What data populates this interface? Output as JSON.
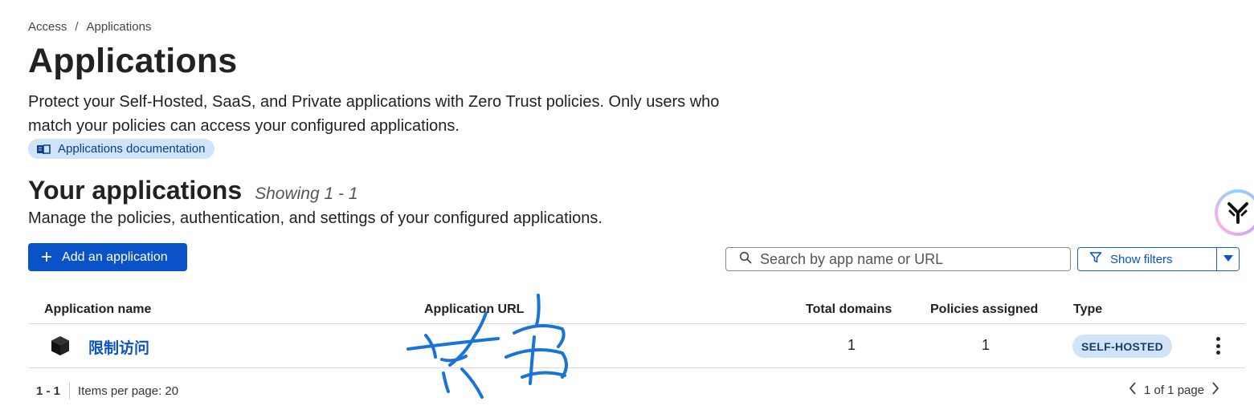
{
  "breadcrumb": {
    "items": [
      "Access",
      "Applications"
    ],
    "separator": "/"
  },
  "page": {
    "title": "Applications",
    "description": "Protect your Self-Hosted, SaaS, and Private applications with Zero Trust policies. Only users who match your policies can access your configured applications.",
    "doc_link_label": "Applications documentation",
    "doc_icon": "book-icon"
  },
  "section": {
    "title": "Your applications",
    "showing": "Showing 1 - 1",
    "description": "Manage the policies, authentication, and settings of your configured applications."
  },
  "toolbar": {
    "add_label": "Add an application",
    "search_placeholder": "Search by app name or URL",
    "search_value": "",
    "filters_label": "Show filters"
  },
  "table": {
    "columns": [
      "Application name",
      "Application URL",
      "Total domains",
      "Policies assigned",
      "Type"
    ],
    "rows": [
      {
        "icon": "cube-icon",
        "name": "限制访问",
        "url": "",
        "total_domains": "1",
        "policies_assigned": "1",
        "type": "SELF-HOSTED"
      }
    ]
  },
  "pagination": {
    "range": "1 - 1",
    "items_per_page": "Items per page: 20",
    "page_status": "1 of 1 page"
  },
  "colors": {
    "primary": "#0a52c7",
    "pill_bg": "#cfe3f9",
    "text": "#222222"
  }
}
